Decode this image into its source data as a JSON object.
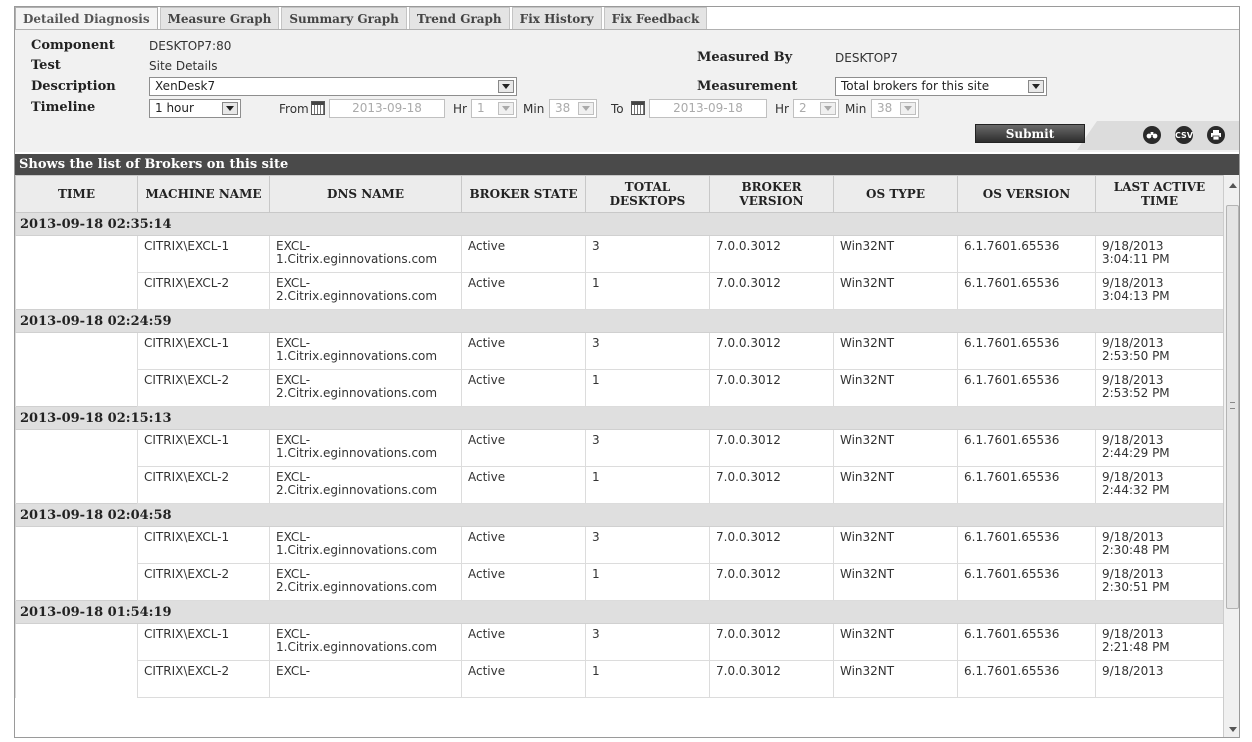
{
  "tabs": [
    "Detailed Diagnosis",
    "Measure Graph",
    "Summary Graph",
    "Trend Graph",
    "Fix History",
    "Fix Feedback"
  ],
  "form": {
    "component_label": "Component",
    "component_value": "DESKTOP7:80",
    "test_label": "Test",
    "test_value": "Site Details",
    "description_label": "Description",
    "description_value": "XenDesk7",
    "timeline_label": "Timeline",
    "timeline_value": "1 hour",
    "measured_by_label": "Measured By",
    "measured_by_value": "DESKTOP7",
    "measurement_label": "Measurement",
    "measurement_value": "Total brokers for this site",
    "from_label": "From",
    "from_date": "2013-09-18",
    "from_hr_label": "Hr",
    "from_hr": "1",
    "from_min_label": "Min",
    "from_min": "38",
    "to_label": "To",
    "to_date": "2013-09-18",
    "to_hr_label": "Hr",
    "to_hr": "2",
    "to_min_label": "Min",
    "to_min": "38",
    "submit_label": "Submit",
    "csv_label": "CSV"
  },
  "grid": {
    "title": "Shows the list of Brokers on this site",
    "columns": [
      "TIME",
      "MACHINE NAME",
      "DNS NAME",
      "BROKER STATE",
      "TOTAL DESKTOPS",
      "BROKER VERSION",
      "OS TYPE",
      "OS VERSION",
      "LAST ACTIVE TIME"
    ],
    "groups": [
      {
        "time": "2013-09-18 02:35:14",
        "rows": [
          {
            "machine": "CITRIX\\EXCL-1",
            "dns": "EXCL-\n1.Citrix.eginnovations.com",
            "state": "Active",
            "desktops": "3",
            "version": "7.0.0.3012",
            "os_type": "Win32NT",
            "os_version": "6.1.7601.65536",
            "last_active": "9/18/2013\n3:04:11 PM"
          },
          {
            "machine": "CITRIX\\EXCL-2",
            "dns": "EXCL-\n2.Citrix.eginnovations.com",
            "state": "Active",
            "desktops": "1",
            "version": "7.0.0.3012",
            "os_type": "Win32NT",
            "os_version": "6.1.7601.65536",
            "last_active": "9/18/2013\n3:04:13 PM"
          }
        ]
      },
      {
        "time": "2013-09-18 02:24:59",
        "rows": [
          {
            "machine": "CITRIX\\EXCL-1",
            "dns": "EXCL-\n1.Citrix.eginnovations.com",
            "state": "Active",
            "desktops": "3",
            "version": "7.0.0.3012",
            "os_type": "Win32NT",
            "os_version": "6.1.7601.65536",
            "last_active": "9/18/2013\n2:53:50 PM"
          },
          {
            "machine": "CITRIX\\EXCL-2",
            "dns": "EXCL-\n2.Citrix.eginnovations.com",
            "state": "Active",
            "desktops": "1",
            "version": "7.0.0.3012",
            "os_type": "Win32NT",
            "os_version": "6.1.7601.65536",
            "last_active": "9/18/2013\n2:53:52 PM"
          }
        ]
      },
      {
        "time": "2013-09-18 02:15:13",
        "rows": [
          {
            "machine": "CITRIX\\EXCL-1",
            "dns": "EXCL-\n1.Citrix.eginnovations.com",
            "state": "Active",
            "desktops": "3",
            "version": "7.0.0.3012",
            "os_type": "Win32NT",
            "os_version": "6.1.7601.65536",
            "last_active": "9/18/2013\n2:44:29 PM"
          },
          {
            "machine": "CITRIX\\EXCL-2",
            "dns": "EXCL-\n2.Citrix.eginnovations.com",
            "state": "Active",
            "desktops": "1",
            "version": "7.0.0.3012",
            "os_type": "Win32NT",
            "os_version": "6.1.7601.65536",
            "last_active": "9/18/2013\n2:44:32 PM"
          }
        ]
      },
      {
        "time": "2013-09-18 02:04:58",
        "rows": [
          {
            "machine": "CITRIX\\EXCL-1",
            "dns": "EXCL-\n1.Citrix.eginnovations.com",
            "state": "Active",
            "desktops": "3",
            "version": "7.0.0.3012",
            "os_type": "Win32NT",
            "os_version": "6.1.7601.65536",
            "last_active": "9/18/2013\n2:30:48 PM"
          },
          {
            "machine": "CITRIX\\EXCL-2",
            "dns": "EXCL-\n2.Citrix.eginnovations.com",
            "state": "Active",
            "desktops": "1",
            "version": "7.0.0.3012",
            "os_type": "Win32NT",
            "os_version": "6.1.7601.65536",
            "last_active": "9/18/2013\n2:30:51 PM"
          }
        ]
      },
      {
        "time": "2013-09-18 01:54:19",
        "rows": [
          {
            "machine": "CITRIX\\EXCL-1",
            "dns": "EXCL-\n1.Citrix.eginnovations.com",
            "state": "Active",
            "desktops": "3",
            "version": "7.0.0.3012",
            "os_type": "Win32NT",
            "os_version": "6.1.7601.65536",
            "last_active": "9/18/2013\n2:21:48 PM"
          },
          {
            "machine": "CITRIX\\EXCL-2",
            "dns": "EXCL-",
            "state": "Active",
            "desktops": "1",
            "version": "7.0.0.3012",
            "os_type": "Win32NT",
            "os_version": "6.1.7601.65536",
            "last_active": "9/18/2013"
          }
        ]
      }
    ]
  }
}
